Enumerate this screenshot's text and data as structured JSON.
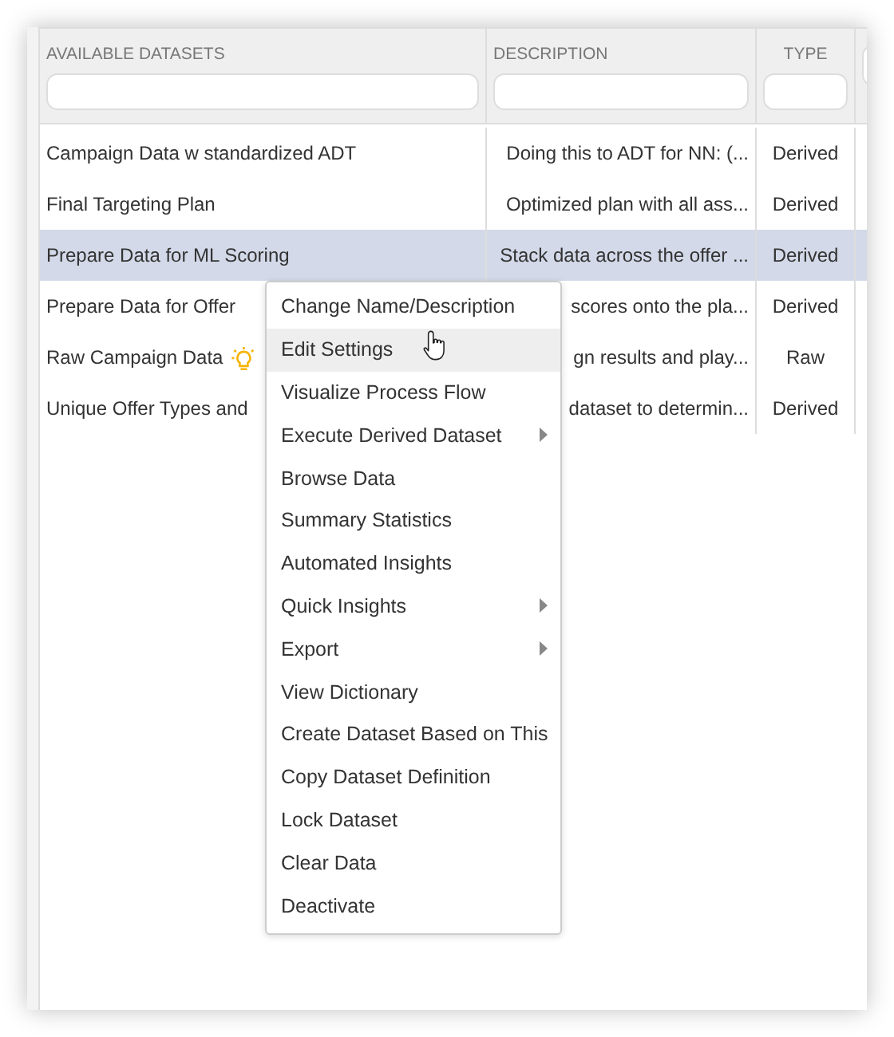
{
  "table": {
    "columns": [
      {
        "label": "AVAILABLE DATASETS"
      },
      {
        "label": "DESCRIPTION"
      },
      {
        "label": "TYPE"
      },
      {}
    ],
    "rows": [
      {
        "name": "Campaign Data w standardized ADT",
        "description": "Doing this to ADT for NN: (...",
        "type": "Derived",
        "selected": false,
        "bulb": false
      },
      {
        "name": "Final Targeting Plan",
        "description": "Optimized plan with all ass...",
        "type": "Derived",
        "selected": false,
        "bulb": false
      },
      {
        "name": "Prepare Data for ML Scoring",
        "description": "Stack data across the offer ...",
        "type": "Derived",
        "selected": true,
        "bulb": false
      },
      {
        "name": "Prepare Data for Offer",
        "description": "scores onto the pla...",
        "type": "Derived",
        "selected": false,
        "bulb": false
      },
      {
        "name": "Raw Campaign Data",
        "description": "gn results and play...",
        "type": "Raw",
        "selected": false,
        "bulb": true
      },
      {
        "name": "Unique Offer Types and",
        "description": "dataset to determin...",
        "type": "Derived",
        "selected": false,
        "bulb": false
      }
    ]
  },
  "context_menu": {
    "items": [
      {
        "label": "Change Name/Description",
        "selected": false,
        "submenu": false
      },
      {
        "label": "Edit Settings",
        "selected": true,
        "submenu": false
      },
      {
        "label": "Visualize Process Flow",
        "selected": false,
        "submenu": false
      },
      {
        "label": "Execute Derived Dataset",
        "selected": false,
        "submenu": true
      },
      {
        "label": "Browse Data",
        "selected": false,
        "submenu": false
      },
      {
        "label": "Summary Statistics",
        "selected": false,
        "submenu": false
      },
      {
        "label": "Automated Insights",
        "selected": false,
        "submenu": false
      },
      {
        "label": "Quick Insights",
        "selected": false,
        "submenu": true
      },
      {
        "label": "Export",
        "selected": false,
        "submenu": true
      },
      {
        "label": "View Dictionary",
        "selected": false,
        "submenu": false
      },
      {
        "label": "Create Dataset Based on This",
        "selected": false,
        "submenu": false
      },
      {
        "label": "Copy Dataset Definition",
        "selected": false,
        "submenu": false
      },
      {
        "label": "Lock Dataset",
        "selected": false,
        "submenu": false
      },
      {
        "label": "Clear Data",
        "selected": false,
        "submenu": false
      },
      {
        "label": "Deactivate",
        "selected": false,
        "submenu": false
      }
    ]
  }
}
